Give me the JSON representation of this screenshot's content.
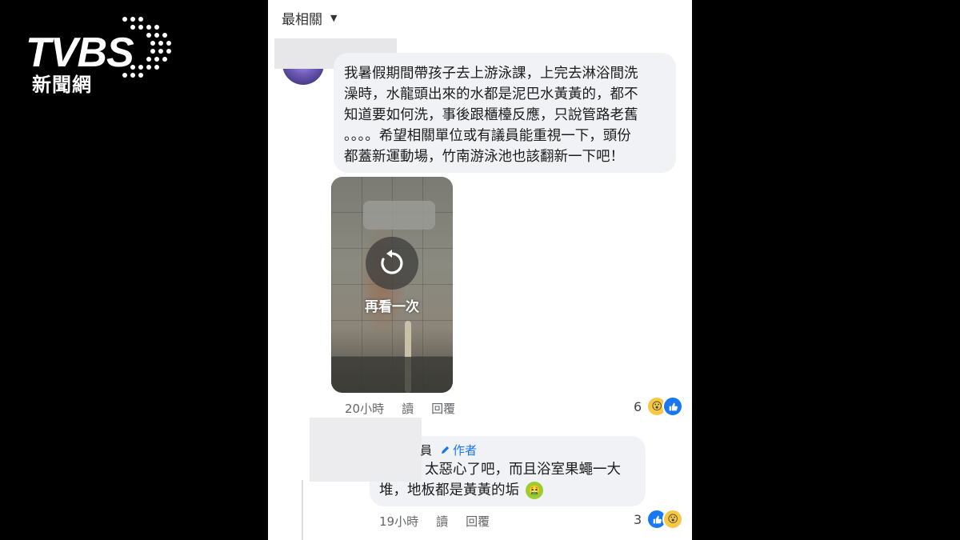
{
  "logo": {
    "brand": "TVBS",
    "subtitle": "新聞網"
  },
  "sort": {
    "label": "最相關"
  },
  "comment1": {
    "text_lines": [
      "我暑假期間帶孩子去上游泳課，上完去淋浴間洗",
      "澡時，水龍頭出來的水都是泥巴水黃黃的，都不",
      "知道要如何洗，事後跟櫃檯反應，只說管路老舊",
      "。。。。希望相關單位或有議員能重視一下，頭份",
      "都蓋新運動場，竹南游泳池也該翻新一下吧！"
    ],
    "video": {
      "replay_label": "再看一次"
    },
    "time": "20小時",
    "read": "讀",
    "reply": "回覆",
    "reaction_count": "6",
    "reactions": [
      "wow-emoji",
      "like-emoji"
    ]
  },
  "comment2": {
    "author_partial": "員",
    "author_badge": "作者",
    "text_line1": "太惡心了吧，而且浴室果蠅一大",
    "text_line2": "堆，地板都是黃黃的垢",
    "time": "19小時",
    "read": "讀",
    "reply": "回覆",
    "reaction_count": "3",
    "reactions": [
      "like-emoji",
      "wow-emoji"
    ]
  },
  "colors": {
    "background": "#000000",
    "bubble": "#f0f2f5",
    "link_blue": "#1877f2",
    "meta_gray": "#65676b"
  }
}
